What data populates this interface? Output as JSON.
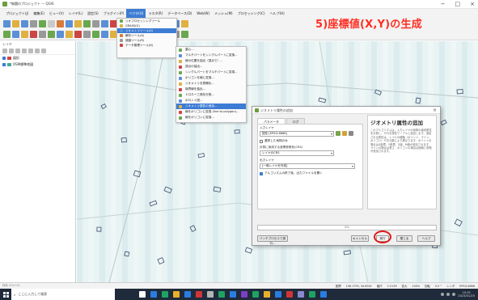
{
  "window": {
    "title": "*無題のプロジェクト — QGIS",
    "controls": [
      "−",
      "□",
      "×"
    ]
  },
  "menu": [
    "プロジェクト(J)",
    "編集(E)",
    "ビュー(V)",
    "レイヤ(L)",
    "設定(S)",
    "プラグイン(P)",
    "ベクタ(O)",
    "ラスタ(R)",
    "データベース(D)",
    "Web(W)",
    "メッシュ(M)",
    "プロセッシング(C)",
    "ヘルプ(H)"
  ],
  "active_menu_index": 6,
  "headline": "5)座標値(X,Y)の生成",
  "layers_panel": {
    "title": "レイヤ",
    "layers": [
      {
        "name": "図形"
      },
      {
        "name": "OSM標準地図"
      }
    ]
  },
  "vector_menu": [
    {
      "label": "ジオプロセッシングツール",
      "icon": "geoprocessing-icon",
      "active": false
    },
    {
      "label": "GRASS(G)",
      "icon": "grass-icon",
      "active": false
    },
    {
      "label": "ジオメトリツール(G)",
      "icon": "geometry-icon",
      "active": true
    },
    {
      "label": "解析ツール(A)",
      "icon": "analysis-icon",
      "active": false
    },
    {
      "label": "調査ツール(R)",
      "icon": "research-icon",
      "active": false
    },
    {
      "label": "データ管理ツール(D)",
      "icon": "data-management-icon",
      "active": false
    }
  ],
  "geometry_submenu": [
    {
      "label": "重心...",
      "highlighted": false
    },
    {
      "label": "マルチパートをシングルパートに変換...",
      "highlighted": false
    },
    {
      "label": "線の位置を抽出（頂点で）...",
      "highlighted": false
    },
    {
      "label": "頂点の抽出...",
      "highlighted": false
    },
    {
      "label": "シングルパートをマルチパートに変換...",
      "highlighted": false
    },
    {
      "label": "ポリゴンを線に変換...",
      "highlighted": false
    },
    {
      "label": "ジオメトリを簡略化...",
      "highlighted": false
    },
    {
      "label": "境界線を抽出...",
      "highlighted": false
    },
    {
      "label": "ドロネー三角形分割...",
      "highlighted": false
    },
    {
      "label": "ボロノイ図...",
      "highlighted": false
    },
    {
      "label": "ジオメトリ属性の追加...",
      "highlighted": true
    },
    {
      "label": "線をポリゴンに変換 (line to polygon)...",
      "highlighted": false
    },
    {
      "label": "線をポリゴンに変換...",
      "highlighted": false
    }
  ],
  "dialog": {
    "title": "ジオメトリ属性の追加",
    "tabs": [
      "パラメータ",
      "ログ"
    ],
    "input_label": "入力レイヤ",
    "input_value": "図形 [EPSG:6668]",
    "selected_only_label": "選択した地物のみ",
    "calc_label": "計算に使用する座標参照系(CRS)",
    "calc_value": "レイヤのCRS",
    "output_label": "出力レイヤ",
    "output_value": "[一時レイヤを作成]",
    "open_after_label": "アルゴリズムの終了後、出力ファイルを開く",
    "help_title": "ジオメトリ属性の追加",
    "help_text": "このアルゴリズムは、入力レイヤの地物の幾何属性を計算し、それを属性テーブルに追加します。追加される属性は、レイヤの種類（ポイント、ライン、ポリゴン）や次元数により異なります。ポイントの場合はX座標、Y座標、Z値、M値が追加されます。ラインの場合は長さ、ポリゴンの場合は面積と周長が追加されます。",
    "progress": "0%",
    "buttons": {
      "batch": "バッチプロセスで実行...",
      "cancel": "キャンセル",
      "run": "実行",
      "close": "閉じる",
      "help": "ヘルプ"
    }
  },
  "status_bar": {
    "locator": "検索 (Ctrl+K)",
    "coordinate_label": "座標",
    "coordinate": "136.1795, 34.8541",
    "scale_label": "縮尺",
    "scale": "1:2139",
    "magnifier_label": "拡大",
    "magnifier": "100%",
    "rotation_label": "回転",
    "rotation": "0.0 °",
    "render_label": "レンダ",
    "crs": "EPSG:6668"
  },
  "taskbar": {
    "search_placeholder": "ここに入力して検索",
    "time": "10:32",
    "date": "2023/01/25"
  },
  "colors": {
    "accent": "#3d7cd4",
    "headline": "#ff2e22",
    "map_bg": "#e8f3f3",
    "taskbar": "#1f2a3a"
  }
}
